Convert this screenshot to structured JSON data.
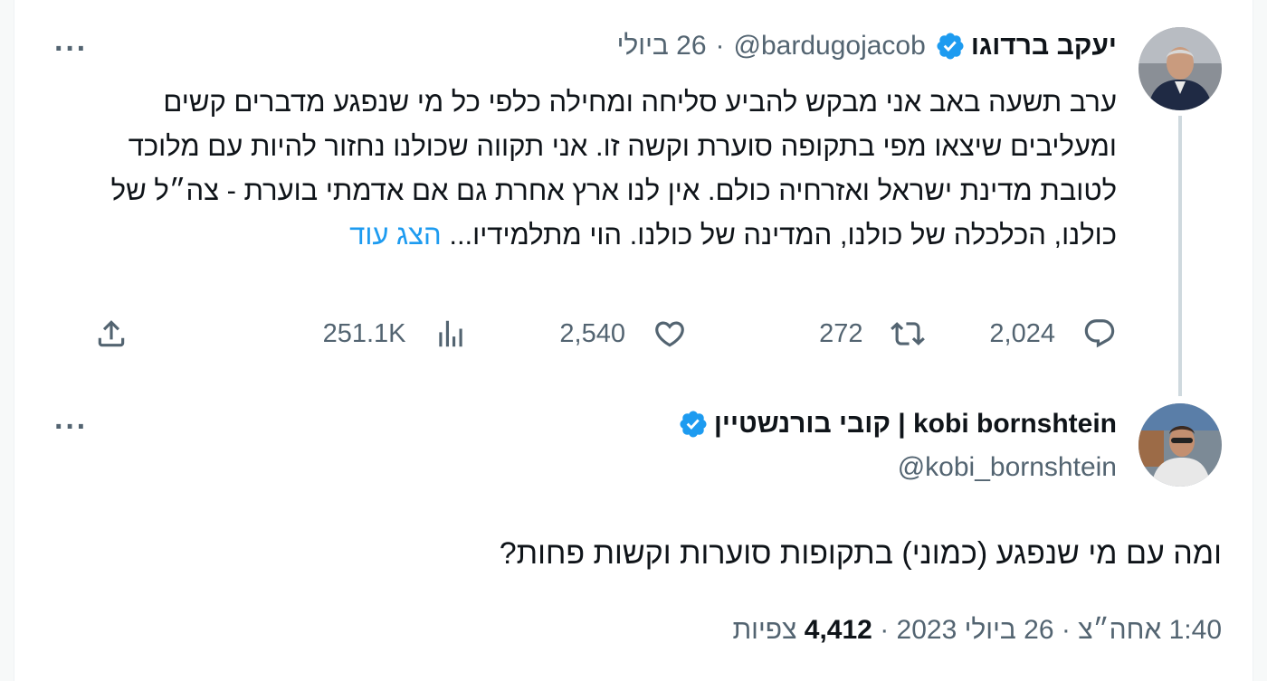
{
  "tweet1": {
    "author_name": "יעקב ברדוגו",
    "handle": "@bardugojacob",
    "date": "26 ביולי",
    "text": "ערב תשעה באב אני מבקש להביע סליחה ומחילה כלפי כל מי שנפגע מדברים קשים ומעליבים שיצאו מפי בתקופה סוערת וקשה זו. אני תקווה שכולנו נחזור להיות עם מלוכד לטובת מדינת ישראל ואזרחיה כולם. אין לנו ארץ אחרת גם אם אדמתי בוערת - צה״ל של כולנו, הכלכלה של כולנו, המדינה של כולנו. הוי מתלמידיו...",
    "show_more": "הצג עוד",
    "counts": {
      "replies": "2,024",
      "retweets": "272",
      "likes": "2,540",
      "views": "251.1K"
    }
  },
  "tweet2": {
    "author_name": "kobi bornshtein | קובי בורנשטיין",
    "handle": "@kobi_bornshtein",
    "text": "ומה עם מי שנפגע (כמוני) בתקופות סוערות וקשות פחות?",
    "time": "1:40 אחה״צ",
    "date": "26 ביולי 2023",
    "views_count": "4,412",
    "views_label": "צפיות"
  },
  "meta_sep": "·",
  "more_label": "···",
  "icons": {
    "more": "more-icon",
    "verified": "verified-badge-icon",
    "reply": "reply-icon",
    "retweet": "retweet-icon",
    "like": "like-icon",
    "views": "views-icon",
    "share": "share-icon"
  },
  "colors": {
    "accent": "#1d9bf0",
    "text": "#0f1419",
    "secondary": "#536471"
  }
}
